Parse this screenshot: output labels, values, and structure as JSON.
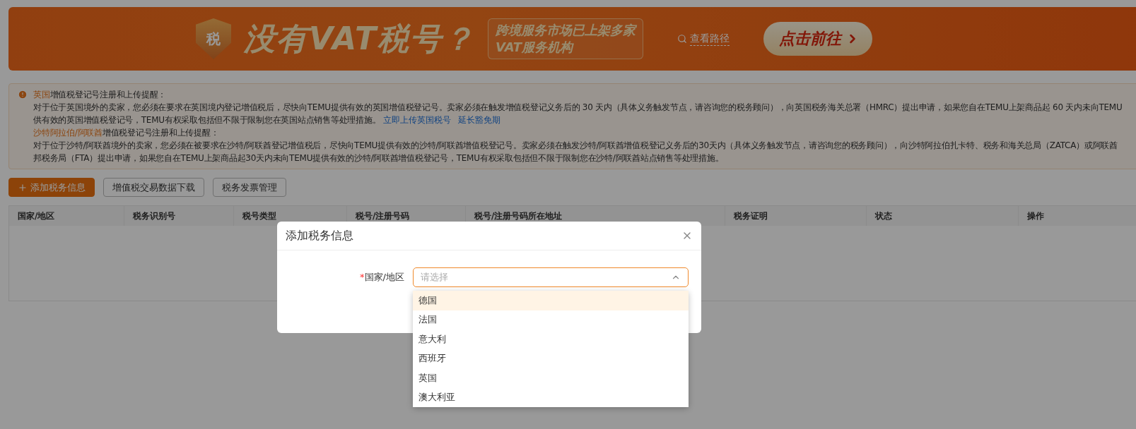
{
  "banner": {
    "badge": "税",
    "headline": "没有VAT税号？",
    "subline_1": "跨境服务市场已上架多家",
    "subline_2": "VAT服务机构",
    "link": "查看路径",
    "button": "点击前往"
  },
  "notices": [
    {
      "region": "英国",
      "title": "增值税登记号注册和上传提醒：",
      "lines": [
        "对于位于英国境外的卖家，您必须在要求在英国境内登记增值税后，尽快向TEMU提供有效的英国增值税登记号。卖家必须在触发增值税登记义务后的 30 天内（具体义务触发节点，请咨询您的税务顾问），向英国税务海关总署（HMRC）提出申请，如果您自在TEMU上架商品起 60 天内未向TEMU",
        "供有效的英国增值税登记号，TEMU有权采取包括但不限于限制您在英国站点销售等处理措施。"
      ],
      "links": [
        "立即上传英国税号",
        "延长豁免期"
      ]
    },
    {
      "region": "沙特阿拉伯/阿联酋",
      "title": "增值税登记号注册和上传提醒：",
      "lines": [
        "对于位于沙特/阿联酋境外的卖家，您必须在被要求在沙特/阿联酋登记增值税后，尽快向TEMU提供有效的沙特/阿联酋增值税登记号。卖家必须在触发沙特/阿联酋增值税登记义务后的30天内（具体义务触发节点，请咨询您的税务顾问），向沙特阿拉伯扎卡特、税务和海关总局（ZATCA）或阿联酋",
        "邦税务局（FTA）提出申请，如果您自在TEMU上架商品起30天内未向TEMU提供有效的沙特/阿联酋增值税登记号，TEMU有权采取包括但不限于限制您在沙特/阿联酋站点销售等处理措施。"
      ]
    }
  ],
  "toolbar": [
    {
      "label": "添加税务信息",
      "kind": "primary"
    },
    {
      "label": "增值税交易数据下载",
      "kind": "default"
    },
    {
      "label": "税务发票管理",
      "kind": "default"
    }
  ],
  "table": {
    "columns": [
      "国家/地区",
      "税务识别号",
      "税号类型",
      "税号/注册号码",
      "税号/注册号码所在地址",
      "税务证明",
      "状态",
      "操作"
    ]
  },
  "dialog": {
    "title": "添加税务信息",
    "field": {
      "label": "国家/地区",
      "required_mark": "*",
      "placeholder": "请选择",
      "expanded": true
    },
    "options": [
      {
        "label": "德国",
        "highlighted": true
      },
      {
        "label": "法国",
        "highlighted": false
      },
      {
        "label": "意大利",
        "highlighted": false
      },
      {
        "label": "西班牙",
        "highlighted": false
      },
      {
        "label": "英国",
        "highlighted": false
      },
      {
        "label": "澳大利亚",
        "highlighted": false
      }
    ]
  }
}
